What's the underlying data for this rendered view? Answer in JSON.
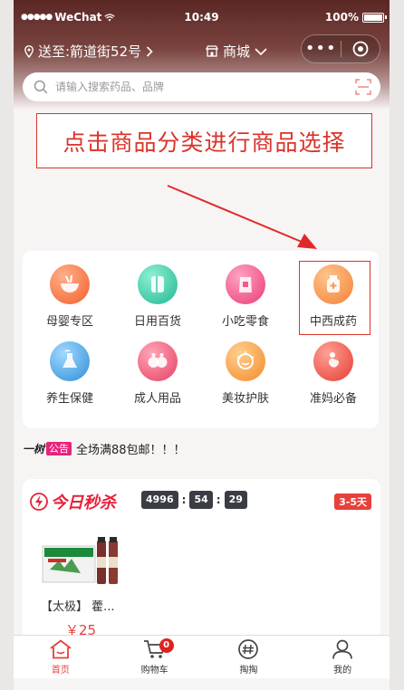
{
  "status_bar": {
    "carrier": "WeChat",
    "time": "10:49",
    "battery": "100%"
  },
  "nav": {
    "address": "送至:箭道街52号",
    "mall": "商城"
  },
  "search": {
    "placeholder": "请输入搜索药品、品牌"
  },
  "instruction": "点击商品分类进行商品选择",
  "categories": [
    {
      "label": "母婴专区",
      "icon": "baby-bowl-icon",
      "color": "#f47a45"
    },
    {
      "label": "日用百货",
      "icon": "towel-icon",
      "color": "#3cc9a8"
    },
    {
      "label": "小吃零食",
      "icon": "snack-bag-icon",
      "color": "#ef5b8b"
    },
    {
      "label": "中西成药",
      "icon": "medicine-bottle-icon",
      "color": "#f79a4a"
    },
    {
      "label": "养生保健",
      "icon": "health-flask-icon",
      "color": "#4aa8e6"
    },
    {
      "label": "成人用品",
      "icon": "adult-icon",
      "color": "#ef5a78"
    },
    {
      "label": "美妆护肤",
      "icon": "beauty-face-icon",
      "color": "#f6a448"
    },
    {
      "label": "准妈必备",
      "icon": "pregnancy-icon",
      "color": "#ee5a55"
    }
  ],
  "notice": {
    "brand": "一树",
    "tag": "公告",
    "text": "全场满88包邮！！！"
  },
  "flash_sale": {
    "title": "今日秒杀",
    "countdown": {
      "hours": "4996",
      "minutes": "54",
      "seconds": "29"
    },
    "badge": "3-5天",
    "product": {
      "name": "【太极】 藿...",
      "price": "￥25"
    }
  },
  "tabs": [
    {
      "label": "首页",
      "icon": "home-icon",
      "active": true
    },
    {
      "label": "购物车",
      "icon": "cart-icon",
      "badge": "0"
    },
    {
      "label": "掏掏",
      "icon": "hashtag-chat-icon"
    },
    {
      "label": "我的",
      "icon": "user-icon"
    }
  ],
  "colors": {
    "accent": "#e8403a",
    "header": "#5a2724",
    "highlight_border": "#d9342b"
  }
}
